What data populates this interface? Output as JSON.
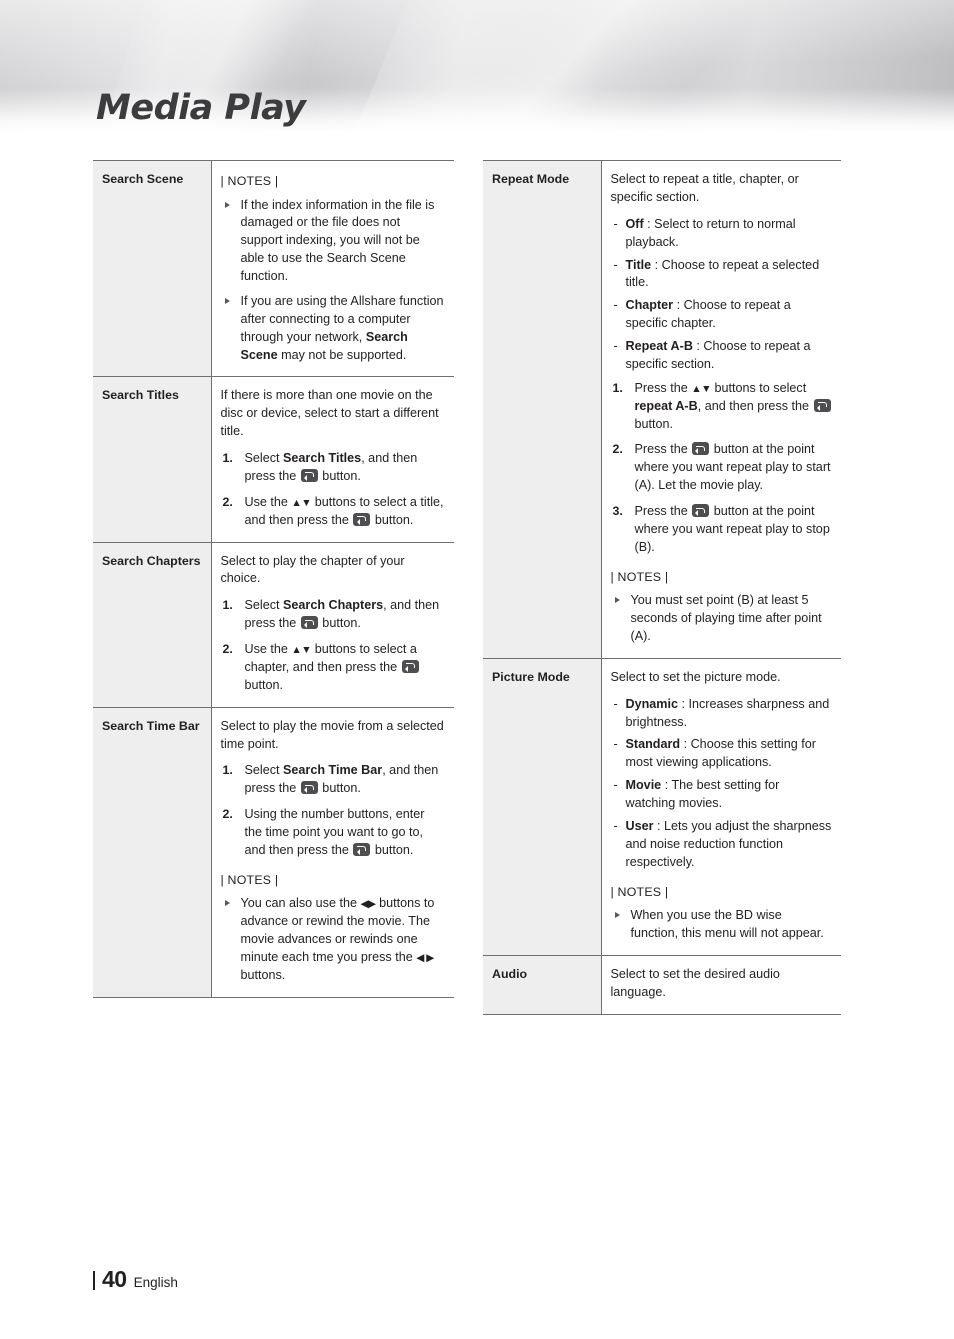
{
  "page": {
    "title": "Media Play",
    "number": "40",
    "language": "English"
  },
  "icons": {
    "enter_key": "enter-key-icon",
    "up_down": "▲▼",
    "left_right": "◀▶",
    "left": "◀",
    "right": "▶"
  },
  "left_column": {
    "rows": [
      {
        "label": "Search Scene",
        "notes_heading": "| NOTES |",
        "notes": [
          {
            "parts": [
              {
                "t": "If the index information in the file is damaged or the file does not support indexing, you will not be able to use the Search Scene function."
              }
            ]
          },
          {
            "parts": [
              {
                "t": "If you are using the Allshare function after connecting to a computer through your network, "
              },
              {
                "t": "Search Scene",
                "b": true
              },
              {
                "t": " may not be supported."
              }
            ]
          }
        ]
      },
      {
        "label": "Search Titles",
        "intro": "If there is more than one movie on the disc or device, select to start a different title.",
        "steps": [
          {
            "parts": [
              {
                "t": "Select "
              },
              {
                "t": "Search Titles",
                "b": true
              },
              {
                "t": ", and then press the "
              },
              {
                "icon": "enter"
              },
              {
                "t": " button."
              }
            ]
          },
          {
            "parts": [
              {
                "t": "Use the "
              },
              {
                "t": "▲▼",
                "arr": true
              },
              {
                "t": " buttons to select a title, and then press the "
              },
              {
                "icon": "enter"
              },
              {
                "t": " button."
              }
            ]
          }
        ]
      },
      {
        "label": "Search Chapters",
        "intro": "Select to play the chapter of your choice.",
        "steps": [
          {
            "parts": [
              {
                "t": "Select "
              },
              {
                "t": "Search Chapters",
                "b": true
              },
              {
                "t": ", and then press the "
              },
              {
                "icon": "enter"
              },
              {
                "t": " button."
              }
            ]
          },
          {
            "parts": [
              {
                "t": "Use the "
              },
              {
                "t": "▲▼",
                "arr": true
              },
              {
                "t": " buttons to select a chapter, and then press the "
              },
              {
                "icon": "enter"
              },
              {
                "t": " button."
              }
            ]
          }
        ]
      },
      {
        "label": "Search Time Bar",
        "intro": "Select to play the movie from a selected time point.",
        "steps": [
          {
            "parts": [
              {
                "t": "Select "
              },
              {
                "t": "Search Time Bar",
                "b": true
              },
              {
                "t": ", and then press the "
              },
              {
                "icon": "enter"
              },
              {
                "t": " button."
              }
            ]
          },
          {
            "parts": [
              {
                "t": "Using the number buttons, enter the time point you want to go to, and then press the "
              },
              {
                "icon": "enter"
              },
              {
                "t": " button."
              }
            ]
          }
        ],
        "notes_heading": "| NOTES |",
        "notes": [
          {
            "parts": [
              {
                "t": "You can also use the "
              },
              {
                "t": "◀▶",
                "arr": true
              },
              {
                "t": " buttons to advance or rewind the movie. The movie advances or rewinds one minute each tme you press the "
              },
              {
                "t": "◀ ▶",
                "arr": true
              },
              {
                "t": " buttons."
              }
            ]
          }
        ]
      }
    ]
  },
  "right_column": {
    "rows": [
      {
        "label": "Repeat Mode",
        "intro": "Select to repeat a title, chapter, or specific section.",
        "dashes": [
          {
            "parts": [
              {
                "t": "Off",
                "b": true
              },
              {
                "t": " : Select to return to normal playback."
              }
            ]
          },
          {
            "parts": [
              {
                "t": "Title",
                "b": true
              },
              {
                "t": " : Choose to repeat a selected title."
              }
            ]
          },
          {
            "parts": [
              {
                "t": "Chapter",
                "b": true
              },
              {
                "t": " : Choose to repeat a specific chapter."
              }
            ]
          },
          {
            "parts": [
              {
                "t": "Repeat A-B",
                "b": true
              },
              {
                "t": " : Choose to repeat a specific section."
              }
            ]
          }
        ],
        "steps": [
          {
            "parts": [
              {
                "t": "Press the "
              },
              {
                "t": "▲▼",
                "arr": true
              },
              {
                "t": " buttons to select "
              },
              {
                "t": "repeat A-B",
                "b": true
              },
              {
                "t": ", and then press the "
              },
              {
                "icon": "enter"
              },
              {
                "t": " button."
              }
            ]
          },
          {
            "parts": [
              {
                "t": "Press the "
              },
              {
                "icon": "enter"
              },
              {
                "t": " button at the point where you want repeat play to start (A). Let the movie play."
              }
            ]
          },
          {
            "parts": [
              {
                "t": "Press the "
              },
              {
                "icon": "enter"
              },
              {
                "t": " button at the point where you want repeat play to stop (B)."
              }
            ]
          }
        ],
        "notes_heading": "| NOTES |",
        "notes": [
          {
            "parts": [
              {
                "t": "You must set point (B) at least 5 seconds of playing time after point (A)."
              }
            ]
          }
        ]
      },
      {
        "label": "Picture Mode",
        "intro": "Select to set the picture mode.",
        "dashes": [
          {
            "parts": [
              {
                "t": "Dynamic",
                "b": true
              },
              {
                "t": " : Increases sharpness and brightness."
              }
            ]
          },
          {
            "parts": [
              {
                "t": "Standard",
                "b": true
              },
              {
                "t": " : Choose this setting for most viewing applications."
              }
            ]
          },
          {
            "parts": [
              {
                "t": "Movie",
                "b": true
              },
              {
                "t": " : The best setting for watching movies."
              }
            ]
          },
          {
            "parts": [
              {
                "t": "User",
                "b": true
              },
              {
                "t": " : Lets you adjust the sharpness and noise reduction function respectively."
              }
            ]
          }
        ],
        "notes_heading": "| NOTES |",
        "notes": [
          {
            "parts": [
              {
                "t": "When you use the BD wise function, this menu will not appear."
              }
            ]
          }
        ]
      },
      {
        "label": "Audio",
        "intro": "Select to set the desired audio language."
      }
    ]
  }
}
